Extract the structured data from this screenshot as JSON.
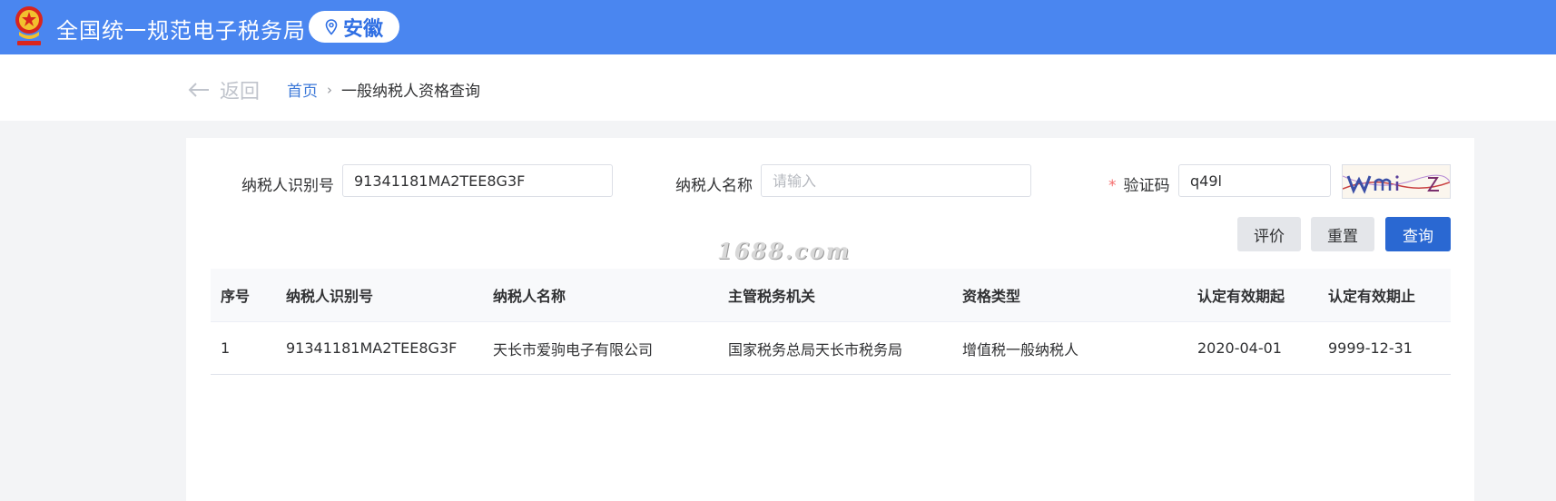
{
  "header": {
    "title": "全国统一规范电子税务局",
    "region": "安徽",
    "emblem_color": "#d9251d",
    "bg_color": "#4a86f0"
  },
  "nav": {
    "back_label": "返回",
    "breadcrumb_home": "首页",
    "breadcrumb_separator": "›",
    "breadcrumb_current": "一般纳税人资格查询"
  },
  "form": {
    "taxpayer_id": {
      "label": "纳税人识别号",
      "value": "91341181MA2TEE8G3F"
    },
    "taxpayer_name": {
      "label": "纳税人名称",
      "value": "",
      "placeholder": "请输入"
    },
    "captcha": {
      "required_mark": "*",
      "label": "验证码",
      "value": "q49l"
    }
  },
  "buttons": {
    "evaluate": "评价",
    "reset": "重置",
    "query": "查询",
    "primary_color": "#2a68d2"
  },
  "watermark": "1688.com",
  "table": {
    "columns": [
      "序号",
      "纳税人识别号",
      "纳税人名称",
      "主管税务机关",
      "资格类型",
      "认定有效期起",
      "认定有效期止"
    ],
    "rows": [
      [
        "1",
        "91341181MA2TEE8G3F",
        "天长市爱驹电子有限公司",
        "国家税务总局天长市税务局",
        "增值税一般纳税人",
        "2020-04-01",
        "9999-12-31"
      ]
    ]
  }
}
